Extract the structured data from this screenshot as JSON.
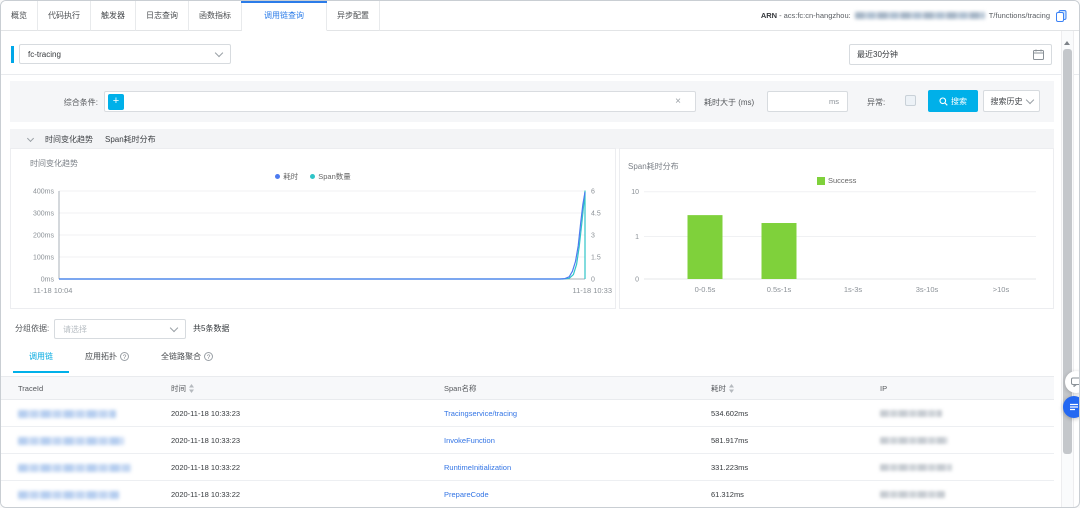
{
  "tabbar": {
    "tabs": [
      {
        "label": "概览"
      },
      {
        "label": "代码执行"
      },
      {
        "label": "触发器"
      },
      {
        "label": "日志查询"
      },
      {
        "label": "函数指标"
      },
      {
        "label": "调用链查询",
        "active": true
      },
      {
        "label": "异步配置"
      }
    ],
    "arn": {
      "label": "ARN",
      "separator": " - ",
      "visible_prefix": "acs:fc:cn-hangzhou:",
      "redacted_middle": true,
      "visible_suffix": "T/functions/tracing"
    }
  },
  "toolbar": {
    "service_select_value": "fc-tracing",
    "time_range_value": "最近30分钟"
  },
  "filter": {
    "condition_label": "综合条件:",
    "add_button": "+",
    "duration_label": "耗时大于 (ms)",
    "duration_unit": "ms",
    "error_label": "异常:",
    "error_checked": false,
    "search_button": "搜索",
    "search_history_button": "搜索历史"
  },
  "section": {
    "title_left": "时间变化趋势",
    "title_right": "Span耗时分布"
  },
  "chart_data": [
    {
      "type": "line",
      "title": "时间变化趋势",
      "x_labels": [
        "11-18 10:04",
        "11-18 10:33"
      ],
      "y_left_ticks": [
        "400ms",
        "300ms",
        "200ms",
        "100ms",
        "0ms"
      ],
      "y_right_ticks": [
        "6",
        "4.5",
        "3",
        "1.5",
        "0"
      ],
      "y_left_max": 400,
      "y_right_max": 6,
      "series": [
        {
          "name": "耗时",
          "color": "#4d7bf0",
          "axis": "left",
          "max": 400,
          "points": [
            [
              0,
              0
            ],
            [
              0.952,
              0
            ],
            [
              0.962,
              2
            ],
            [
              0.97,
              10
            ],
            [
              0.976,
              35
            ],
            [
              0.982,
              80
            ],
            [
              0.987,
              150
            ],
            [
              0.992,
              260
            ],
            [
              0.996,
              340
            ],
            [
              1,
              395
            ]
          ]
        },
        {
          "name": "Span数量",
          "color": "#2fc5c8",
          "axis": "right",
          "max": 6,
          "points": [
            [
              0,
              0
            ],
            [
              0.958,
              0
            ],
            [
              0.97,
              0.05
            ],
            [
              0.978,
              0.3
            ],
            [
              0.984,
              1
            ],
            [
              0.989,
              2.2
            ],
            [
              0.994,
              3.8
            ],
            [
              0.998,
              5.2
            ],
            [
              1,
              6
            ],
            [
              1,
              0
            ]
          ]
        }
      ]
    },
    {
      "type": "bar",
      "title": "Span耗时分布",
      "legend": [
        {
          "name": "Success",
          "color": "#7fd13b"
        }
      ],
      "categories": [
        "0-0.5s",
        "0.5s-1s",
        "1s-3s",
        "3s-10s",
        ">10s"
      ],
      "values": [
        3,
        2,
        0,
        0,
        0
      ],
      "y_ticks": [
        "10",
        "1",
        "0"
      ],
      "scale": "log"
    }
  ],
  "grouping": {
    "label": "分组依据:",
    "select_placeholder": "请选择",
    "total_text": "共5条数据"
  },
  "subtabs": [
    {
      "label": "调用链",
      "active": true
    },
    {
      "label": "应用拓扑",
      "help": true
    },
    {
      "label": "全链路聚合",
      "help": true
    }
  ],
  "table": {
    "columns": [
      {
        "label": "TraceId"
      },
      {
        "label": "时间",
        "sortable": true
      },
      {
        "label": "Span名称"
      },
      {
        "label": "耗时",
        "sortable": true
      },
      {
        "label": "IP"
      }
    ],
    "rows": [
      {
        "trace_id_redacted": true,
        "time": "2020-11-18 10:33:23",
        "span_name": "Tracingservice/tracing",
        "duration": "534.602ms",
        "ip_redacted": true
      },
      {
        "trace_id_redacted": true,
        "time": "2020-11-18 10:33:23",
        "span_name": "InvokeFunction",
        "duration": "581.917ms",
        "ip_redacted": true
      },
      {
        "trace_id_redacted": true,
        "time": "2020-11-18 10:33:22",
        "span_name": "RuntimeInitialization",
        "duration": "331.223ms",
        "ip_redacted": true
      },
      {
        "trace_id_redacted": true,
        "time": "2020-11-18 10:33:22",
        "span_name": "PrepareCode",
        "duration": "61.312ms",
        "ip_redacted": true
      }
    ]
  },
  "colors": {
    "accent_cyan": "#00b0e9",
    "tab_active_blue": "#2b7ce9",
    "link_blue": "#3274e5",
    "chart_line_blue": "#4d7bf0",
    "chart_line_teal": "#2fc5c8",
    "chart_bar_green": "#7fd13b"
  }
}
